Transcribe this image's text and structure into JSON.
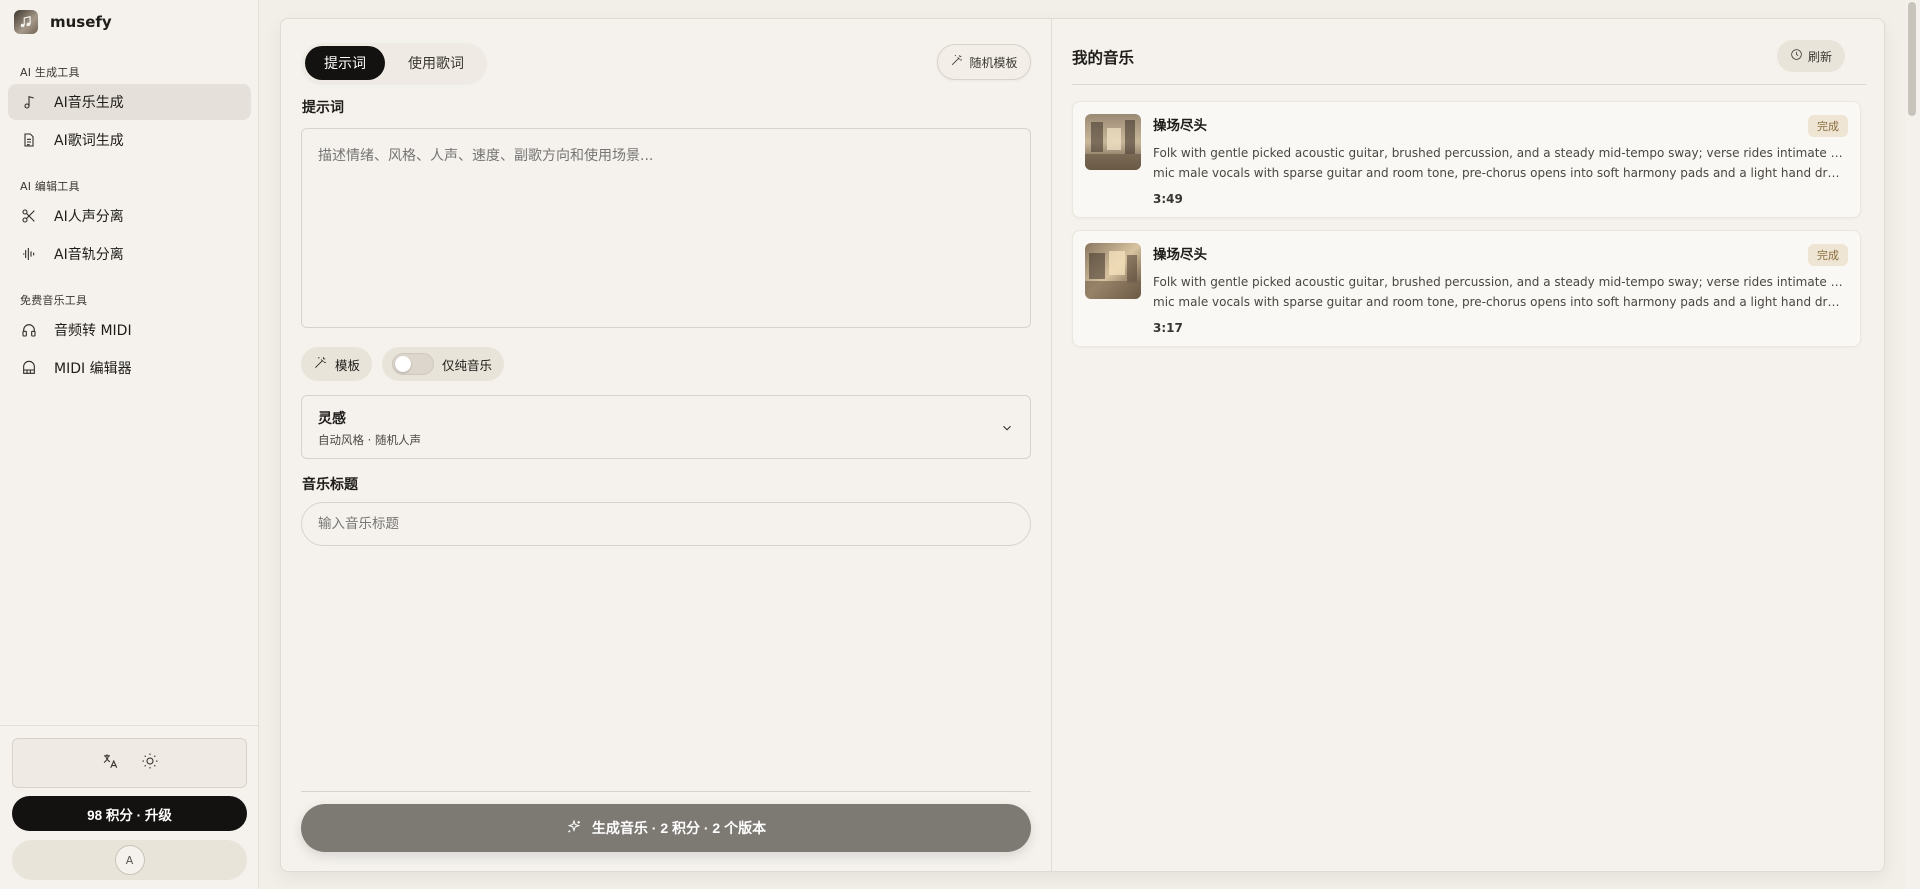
{
  "brand": {
    "name": "musefy",
    "logo_icon": "music-note-icon"
  },
  "sidebar": {
    "sections": [
      {
        "title": "AI 生成工具",
        "items": [
          {
            "label": "AI音乐生成",
            "icon": "music-note-icon",
            "active": true
          },
          {
            "label": "AI歌词生成",
            "icon": "document-icon",
            "active": false
          }
        ]
      },
      {
        "title": "AI 编辑工具",
        "items": [
          {
            "label": "AI人声分离",
            "icon": "scissors-icon",
            "active": false
          },
          {
            "label": "AI音轨分离",
            "icon": "waveform-icon",
            "active": false
          }
        ]
      },
      {
        "title": "免费音乐工具",
        "items": [
          {
            "label": "音频转 MIDI",
            "icon": "audio-to-midi-icon",
            "active": false
          },
          {
            "label": "MIDI 编辑器",
            "icon": "piano-icon",
            "active": false
          }
        ]
      }
    ],
    "utility_icons": [
      "translate-icon",
      "sun-icon"
    ],
    "upgrade_label": "98 积分 · 升级",
    "avatar_initial": "A"
  },
  "composer": {
    "tabs": [
      {
        "label": "提示词",
        "active": true
      },
      {
        "label": "使用歌词",
        "active": false
      }
    ],
    "random_template_label": "随机模板",
    "prompt_label": "提示词",
    "prompt_placeholder": "描述情绪、风格、人声、速度、副歌方向和使用场景...",
    "template_chip_label": "模板",
    "instrumental_label": "仅纯音乐",
    "instrumental_on": false,
    "inspiration_title": "灵感",
    "inspiration_sub": "自动风格 · 随机人声",
    "music_title_label": "音乐标题",
    "music_title_placeholder": "输入音乐标题",
    "generate_label": "生成音乐 · 2 积分 · 2 个版本"
  },
  "my_music": {
    "title": "我的音乐",
    "refresh_label": "刷新",
    "songs": [
      {
        "title": "操场尽头",
        "status": "完成",
        "desc_line1": "Folk with gentle picked acoustic guitar, brushed percussion, and a steady mid-tempo sway; verse rides intimate close-",
        "desc_line2": "mic male vocals with sparse guitar and room tone, pre-chorus opens into soft harmony pads and a light hand drum lift,...",
        "duration": "3:49"
      },
      {
        "title": "操场尽头",
        "status": "完成",
        "desc_line1": "Folk with gentle picked acoustic guitar, brushed percussion, and a steady mid-tempo sway; verse rides intimate close-",
        "desc_line2": "mic male vocals with sparse guitar and room tone, pre-chorus opens into soft harmony pads and a light hand drum lift,...",
        "duration": "3:17"
      }
    ]
  },
  "colors": {
    "background": "#f2efe9",
    "accent_dark": "#141210",
    "generate_button": "#7d7973",
    "status_badge_bg": "#efe5d4",
    "status_badge_text": "#8a6d3e"
  }
}
